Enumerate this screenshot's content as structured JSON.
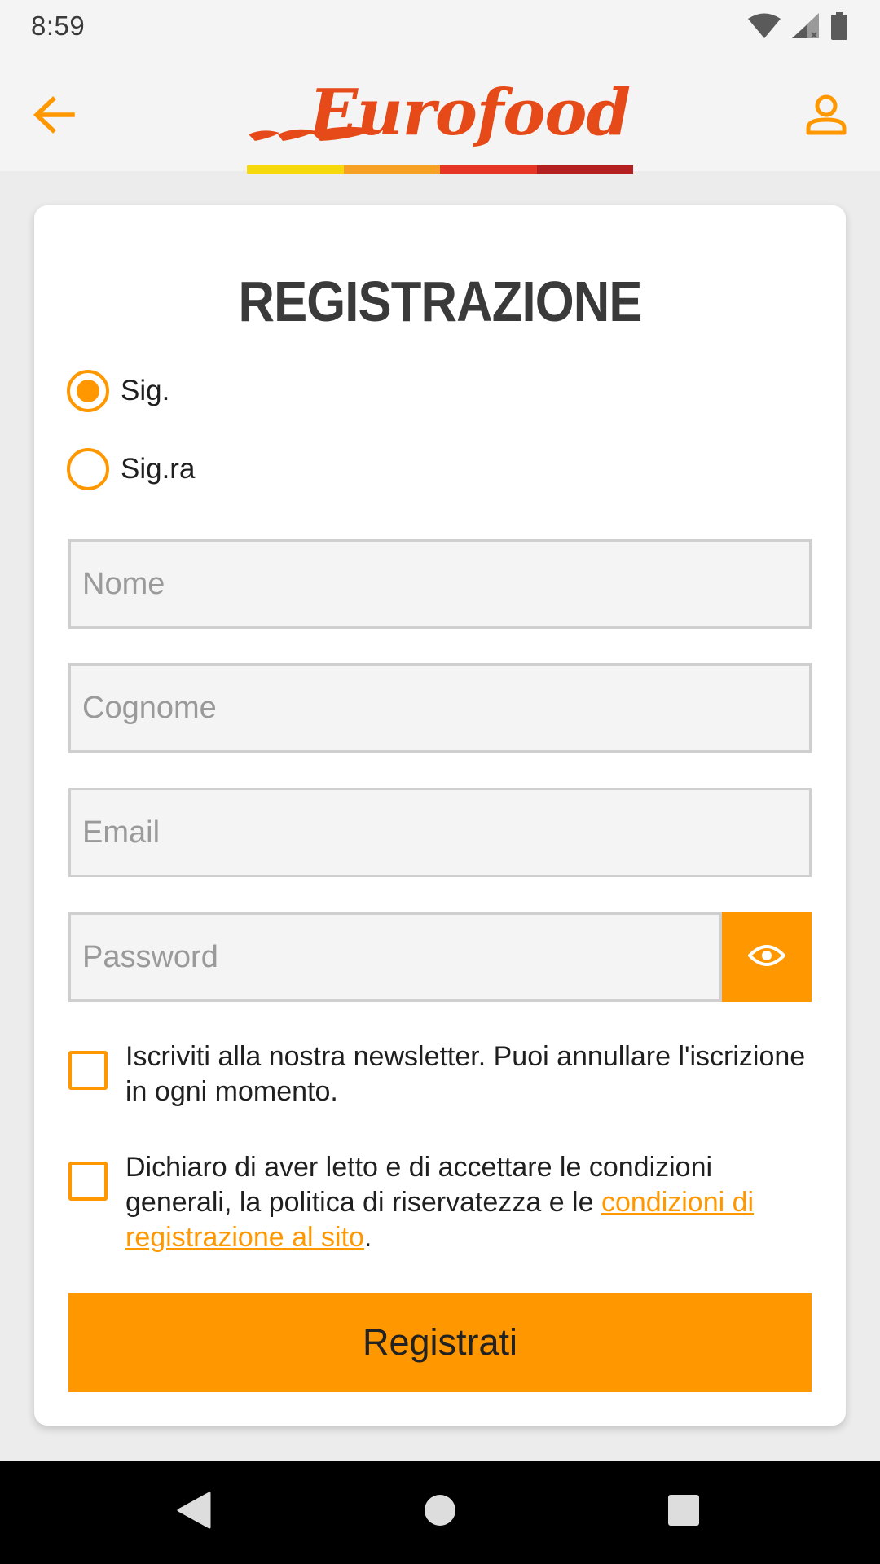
{
  "status_bar": {
    "time": "8:59",
    "icons": [
      "wifi-icon",
      "signal-icon",
      "battery-icon"
    ]
  },
  "header": {
    "back_icon": "arrow-left-icon",
    "account_icon": "user-icon",
    "logo_text": "Eurofood"
  },
  "colors": {
    "accent": "#ff9800",
    "logo_red": "#e64a19",
    "stripe_yellow": "#f5d90a",
    "stripe_orange": "#f6a024",
    "stripe_red": "#e53524",
    "stripe_darkred": "#b41f1f"
  },
  "form": {
    "title": "REGISTRAZIONE",
    "salutations": [
      {
        "label": "Sig.",
        "selected": true
      },
      {
        "label": "Sig.ra",
        "selected": false
      }
    ],
    "fields": {
      "first_name": {
        "placeholder": "Nome",
        "value": ""
      },
      "last_name": {
        "placeholder": "Cognome",
        "value": ""
      },
      "email": {
        "placeholder": "Email",
        "value": ""
      },
      "password": {
        "placeholder": "Password",
        "value": ""
      }
    },
    "password_toggle_icon": "eye-icon",
    "newsletter": {
      "text": "Iscriviti alla nostra newsletter. Puoi annullare l'iscrizione in ogni momento.",
      "checked": false
    },
    "terms": {
      "text_before": "Dichiaro di aver letto e di accettare le condizioni generali, la politica di riservatezza e le ",
      "link_text": "condizioni di registrazione al sito",
      "text_after": ".",
      "checked": false
    },
    "submit_label": "Registrati"
  },
  "nav_bar": {
    "icons": [
      "back-triangle-icon",
      "home-circle-icon",
      "recents-square-icon"
    ]
  }
}
